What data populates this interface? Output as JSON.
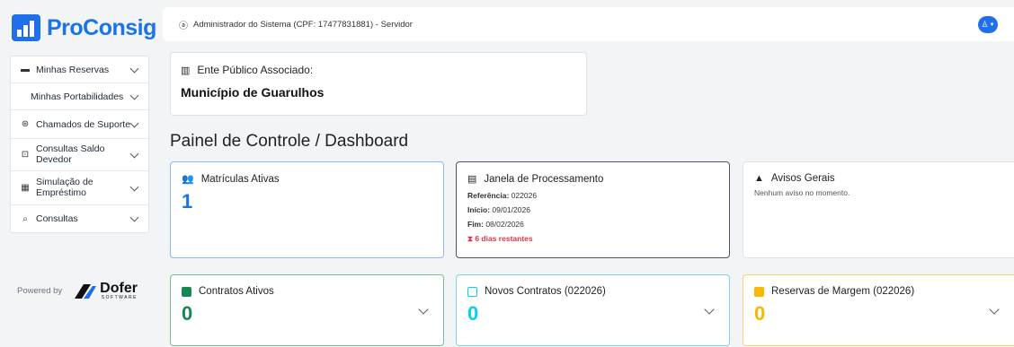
{
  "brand": {
    "name": "ProConsig",
    "color": "#1a73e8"
  },
  "sidebar": {
    "items": [
      {
        "icon": "wallet-icon",
        "label": "Minhas Reservas"
      },
      {
        "icon": "",
        "label": "Minhas Portabilidades"
      },
      {
        "icon": "support-icon",
        "label": "Chamados de Suporte"
      },
      {
        "icon": "money-icon",
        "label": "Consultas Saldo Devedor"
      },
      {
        "icon": "calculator-icon",
        "label": "Simulação de Empréstimo"
      },
      {
        "icon": "search-icon",
        "label": "Consultas"
      }
    ],
    "powered_by": "Powered by",
    "partner_name": "Dofer",
    "partner_sub": "SOFTWARE"
  },
  "topbar": {
    "user_text": "Administrador do Sistema (CPF: 17477831881) - Servidor"
  },
  "ente": {
    "label": "Ente Público Associado:",
    "value": "Município de Guarulhos"
  },
  "page_title": "Painel de Controle / Dashboard",
  "cards": {
    "matriculas": {
      "title": "Matrículas Ativas",
      "value": "1"
    },
    "janela": {
      "title": "Janela de Processamento",
      "ref_label": "Referência:",
      "ref_value": "022026",
      "inicio_label": "Início:",
      "inicio_value": "09/01/2026",
      "fim_label": "Fim:",
      "fim_value": "08/02/2026",
      "restantes": "6 dias restantes"
    },
    "avisos": {
      "title": "Avisos Gerais",
      "text": "Nenhum aviso no momento."
    },
    "contratos": {
      "title": "Contratos Ativos",
      "value": "0"
    },
    "novos": {
      "title": "Novos Contratos (022026)",
      "value": "0"
    },
    "reservas": {
      "title": "Reservas de Margem (022026)",
      "value": "0"
    }
  },
  "colors": {
    "primary": "#1f6feb",
    "success": "#198754",
    "info": "#0dcaf0",
    "warning": "#f5b700",
    "danger": "#dc3545"
  }
}
